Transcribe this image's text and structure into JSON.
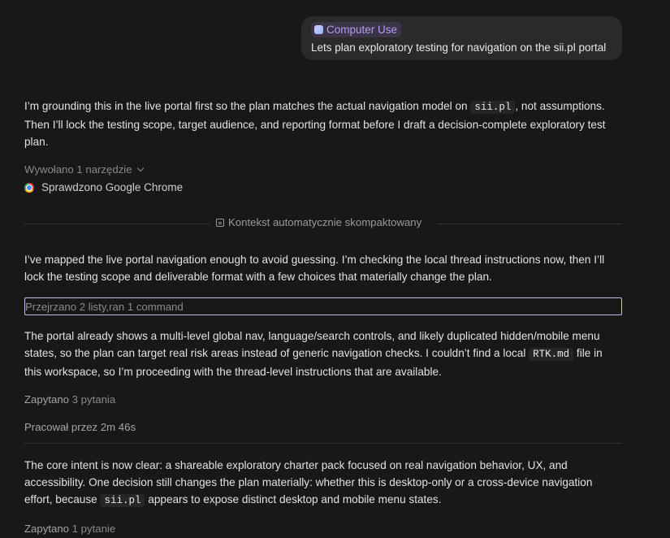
{
  "user_message": {
    "chip_label": "Computer Use",
    "text": "Lets plan exploratory testing for navigation on the sii.pl portal"
  },
  "assistant": {
    "para1": {
      "part1": "I’m grounding this in the live portal first so the plan matches the actual navigation model on ",
      "code": "sii.pl",
      "part2": ", not assumptions. Then I’ll lock the testing scope, target audience, and reporting format before I draft a decision-complete exploratory test plan."
    },
    "tools_called": "Wywołano 1 narzędzie",
    "chrome_checked": "Sprawdzono Google Chrome",
    "compacted_label": "Kontekst automatycznie skompaktowany",
    "para2": "I’ve mapped the live portal navigation enough to avoid guessing. I’m checking the local thread instructions now, then I’ll lock the testing scope and deliverable format with a few choices that materially change the plan.",
    "reviewed_input_value": "Przejrzano 2 listy,ran 1 command",
    "para3": {
      "part1": "The portal already shows a multi-level global nav, language/search controls, and likely duplicated hidden/mobile menu states, so the plan can target real risk areas instead of generic navigation checks. I couldn’t find a local ",
      "code": "RTK.md",
      "part2": " file in this workspace, so I’m proceeding with the thread-level instructions that are available."
    },
    "asked1": {
      "label": "Zapytano",
      "count": "3 pytania"
    },
    "worked": "Pracował przez 2m 46s",
    "para4": {
      "part1": "The core intent is now clear: a shareable exploratory charter pack focused on real navigation behavior, UX, and accessibility. One decision still changes the plan materially: whether this is desktop-only or a cross-device navigation effort, because ",
      "code": "sii.pl",
      "part2": " appears to expose distinct desktop and mobile menu states."
    },
    "asked2": {
      "label": "Zapytano",
      "count": "1 pytanie"
    }
  },
  "colors": {
    "background": "#181818",
    "bubble": "#2a2a2a",
    "chip_text": "#b89cf5",
    "focus_border": "#b7c3ea"
  },
  "icons": [
    "computer-use-icon",
    "chevron-down-icon",
    "chrome-icon",
    "compact-icon"
  ]
}
